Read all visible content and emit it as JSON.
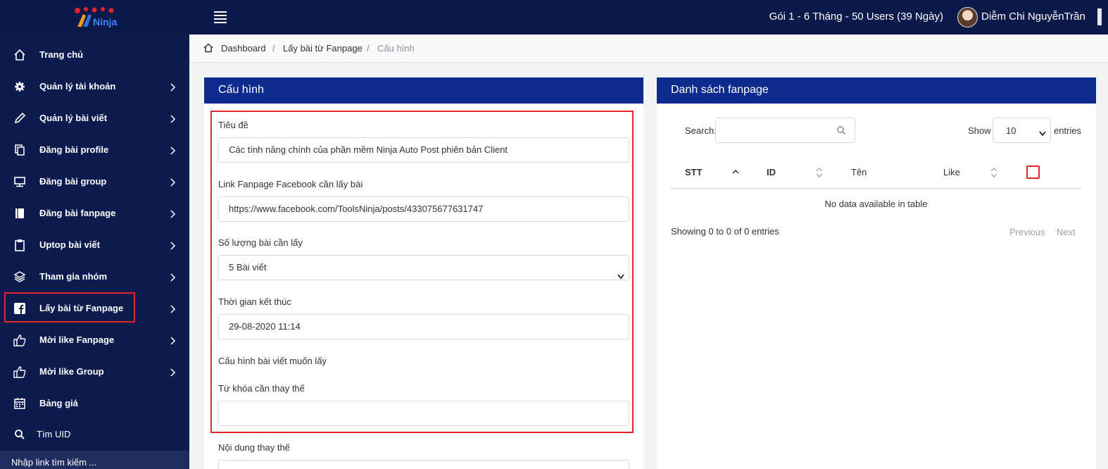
{
  "topbar": {
    "logo_text": "Ninja",
    "plan": "Gói 1 - 6 Tháng - 50 Users (39 Ngày)",
    "username": "Diễm Chi NguyễnTrần"
  },
  "sidebar": {
    "items": [
      {
        "label": "Trang chủ",
        "icon": "home-icon"
      },
      {
        "label": "Quản lý tài khoản",
        "icon": "gear-icon"
      },
      {
        "label": "Quản lý bài viết",
        "icon": "pencil-icon"
      },
      {
        "label": "Đăng bài profile",
        "icon": "copy-icon"
      },
      {
        "label": "Đăng bài group",
        "icon": "monitor-icon"
      },
      {
        "label": "Đăng bài fanpage",
        "icon": "book-icon"
      },
      {
        "label": "Uptop bài viết",
        "icon": "clipboard-icon"
      },
      {
        "label": "Tham gia nhóm",
        "icon": "layers-icon"
      },
      {
        "label": "Lấy bài từ Fanpage",
        "icon": "facebook-icon"
      },
      {
        "label": "Mời like Fanpage",
        "icon": "thumbs-up-icon"
      },
      {
        "label": "Mời like Group",
        "icon": "thumbs-up-icon"
      },
      {
        "label": "Bảng giá",
        "icon": "calendar-icon"
      },
      {
        "label": "Tìm UID",
        "icon": "search-icon"
      }
    ],
    "search_placeholder": "Nhập link tìm kiếm ..."
  },
  "breadcrumb": {
    "items": [
      "Dashboard",
      "Lấy bài từ Fanpage",
      "Cấu hình"
    ],
    "separator": "/"
  },
  "config_panel": {
    "title": "Cấu hình",
    "fields": {
      "title_label": "Tiêu đề",
      "title_value": "Các tính năng chính của phần mềm Ninja Auto Post phiên bản Client",
      "link_label": "Link Fanpage Facebook cần lấy bài",
      "link_value": "https://www.facebook.com/ToolsNinja/posts/433075677631747",
      "count_label": "Số lượng bài cần lấy",
      "count_value": "5 Bài viết",
      "end_time_label": "Thời gian kết thúc",
      "end_time_value": "29-08-2020 11:14",
      "post_config_label": "Cấu hình bài viết muốn lấy",
      "keyword_label": "Từ khóa cần thay thế",
      "keyword_value": "",
      "replace_label": "Nội dung thay thế"
    }
  },
  "fanpage_panel": {
    "title": "Danh sách fanpage",
    "search_label": "Search:",
    "show_label": "Show",
    "show_value": "10",
    "entries_label": "entries",
    "columns": [
      "STT",
      "ID",
      "Tên",
      "Like"
    ],
    "empty_text": "No data available in table",
    "info": "Showing 0 to 0 of 0 entries",
    "prev": "Previous",
    "next": "Next"
  },
  "colors": {
    "topbar": "#0b1a4a",
    "sidebar": "#0c1b4d",
    "panel_header": "#0d2a8e",
    "highlight": "#e0242b"
  }
}
